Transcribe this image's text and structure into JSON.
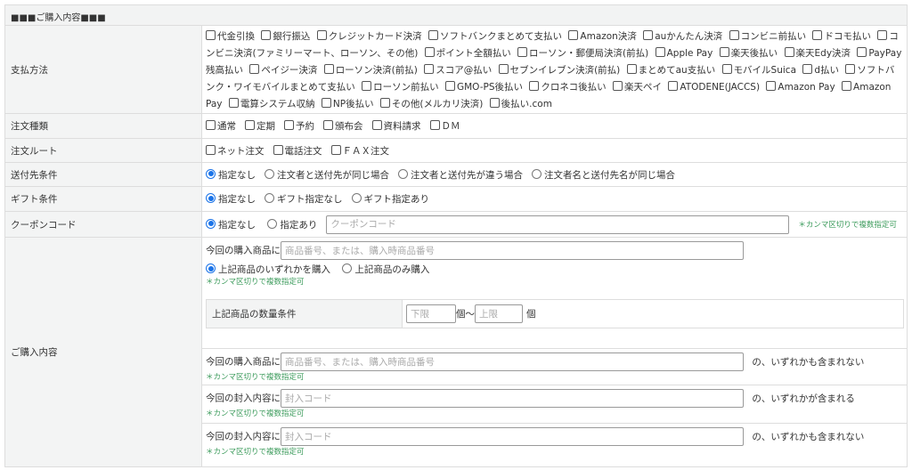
{
  "section_title": "■■■ご購入内容■■■",
  "payment": {
    "label": "支払方法",
    "options": [
      "代金引換",
      "銀行振込",
      "クレジットカード決済",
      "ソフトバンクまとめて支払い",
      "Amazon決済",
      "auかんたん決済",
      "コンビニ前払い",
      "ドコモ払い",
      "コンビニ決済(ファミリーマート、ローソン、その他)",
      "ポイント全額払い",
      "ローソン・郵便局決済(前払)",
      "Apple Pay",
      "楽天後払い",
      "楽天Edy決済",
      "PayPay残高払い",
      "ペイジー決済",
      "ローソン決済(前払)",
      "スコア@払い",
      "セブンイレブン決済(前払)",
      "まとめてau支払い",
      "モバイルSuica",
      "d払い",
      "ソフトバンク・ワイモバイルまとめて支払い",
      "ローソン前払い",
      "GMO-PS後払い",
      "クロネコ後払い",
      "楽天ペイ",
      "ATODENE(JACCS)",
      "Amazon Pay",
      "Amazon Pay",
      "電算システム収納",
      "NP後払い",
      "その他(メルカリ決済)",
      "後払い.com"
    ]
  },
  "order_type": {
    "label": "注文種類",
    "options": [
      "通常",
      "定期",
      "予約",
      "頒布会",
      "資料請求",
      "ＤＭ"
    ]
  },
  "order_route": {
    "label": "注文ルート",
    "options": [
      "ネット注文",
      "電話注文",
      "ＦＡＸ注文"
    ]
  },
  "ship": {
    "label": "送付先条件",
    "options": [
      "指定なし",
      "注文者と送付先が同じ場合",
      "注文者と送付先が違う場合",
      "注文者名と送付先名が同じ場合"
    ],
    "selected": 0
  },
  "gift": {
    "label": "ギフト条件",
    "options": [
      "指定なし",
      "ギフト指定なし",
      "ギフト指定あり"
    ],
    "selected": 0
  },
  "coupon": {
    "label": "クーポンコード",
    "options": [
      "指定なし",
      "指定あり"
    ],
    "selected": 0,
    "placeholder": "クーポンコード",
    "note": "＊カンマ区切りで複数指定可"
  },
  "purchase": {
    "label": "ご購入内容",
    "block1": {
      "prefix": "今回の購入商品に",
      "placeholder": "商品番号、または、購入時商品番号",
      "options": [
        "上記商品のいずれかを購入",
        "上記商品のみ購入"
      ],
      "selected": 0,
      "note": "＊カンマ区切りで複数指定可",
      "qty": {
        "label": "上記商品の数量条件",
        "min_placeholder": "下限",
        "unit_sep": "個～",
        "max_placeholder": "上限",
        "unit": "個"
      }
    },
    "block2": {
      "prefix": "今回の購入商品に",
      "placeholder": "商品番号、または、購入時商品番号",
      "suffix": "の、いずれかも含まれない",
      "note": "＊カンマ区切りで複数指定可"
    },
    "block3": {
      "prefix": "今回の封入内容に",
      "placeholder": "封入コード",
      "suffix": "の、いずれかが含まれる",
      "note": "＊カンマ区切りで複数指定可"
    },
    "block4": {
      "prefix": "今回の封入内容に",
      "placeholder": "封入コード",
      "suffix": "の、いずれかも含まれない",
      "note": "＊カンマ区切りで複数指定可"
    }
  }
}
